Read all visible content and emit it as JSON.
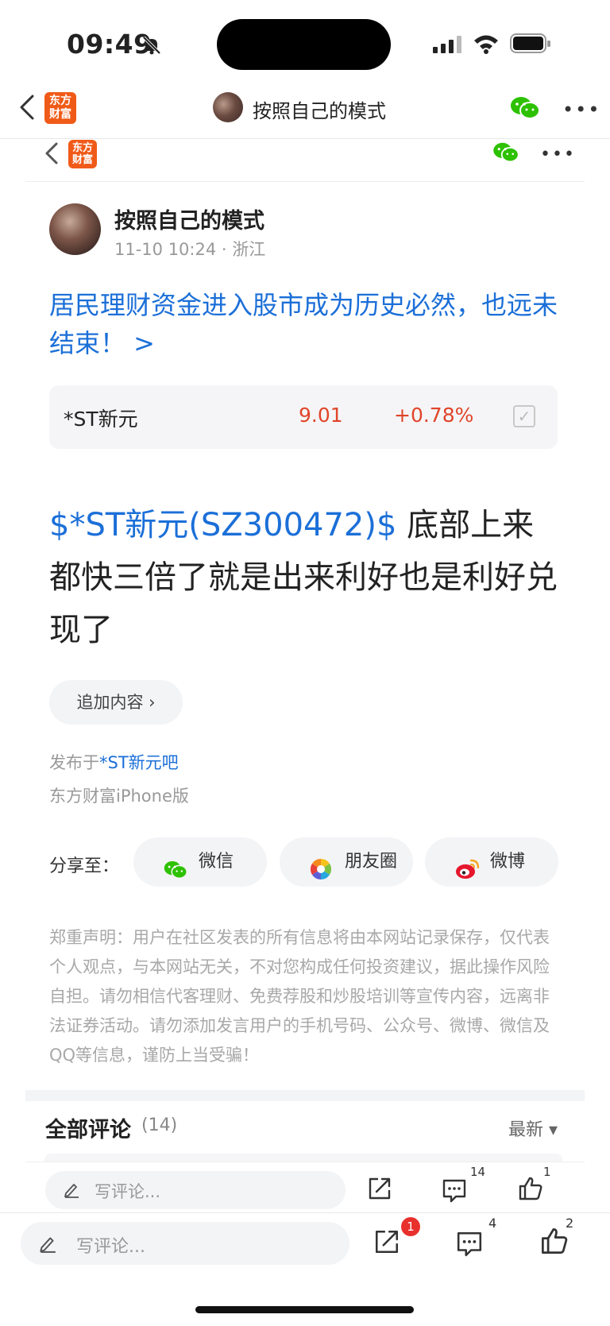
{
  "status_bar": {
    "time": "09:49"
  },
  "nav": {
    "title": "按照自己的模式",
    "logo_text": "东方\n财富",
    "more": "•••"
  },
  "post": {
    "author": "按照自己的模式",
    "meta": "11-10 10:24 · 浙江",
    "title": "居民理财资金进入股市成为历史必然，也远未结束！ >",
    "stock": {
      "name": "*ST新元",
      "price": "9.01",
      "change": "+0.78%"
    },
    "body_tag": "$*ST新元(SZ300472)$",
    "body_text": " 底部上来都快三倍了就是出来利好也是利好兑现了",
    "append_label": "追加内容 ›",
    "published_prefix": "发布于",
    "published_bar": "*ST新元吧",
    "client": "东方财富iPhone版"
  },
  "share": {
    "label": "分享至：",
    "wechat": "微信",
    "moments": "朋友圈",
    "weibo": "微博"
  },
  "disclaimer": "郑重声明：用户在社区发表的所有信息将由本网站记录保存，仅代表个人观点，与本网站无关，不对您构成任何投资建议，据此操作风险自担。请勿相信代客理财、免费荐股和炒股培训等宣传内容，远离非法证券活动。请勿添加发言用户的手机号码、公众号、微博、微信及QQ等信息，谨防上当受骗！",
  "comments": {
    "title": "全部评论",
    "count": "(14)",
    "sort": "最新 ▾"
  },
  "inner_bar": {
    "placeholder": "写评论...",
    "comment_count": "14",
    "like_count": "1"
  },
  "outer_bar": {
    "placeholder": "写评论...",
    "share_badge": "1",
    "comment_count": "4",
    "like_count": "2"
  },
  "colors": {
    "accent_blue": "#1b6fd8",
    "up_red": "#e0452a",
    "brand_orange": "#f05a18",
    "wechat_green": "#2dc100"
  }
}
